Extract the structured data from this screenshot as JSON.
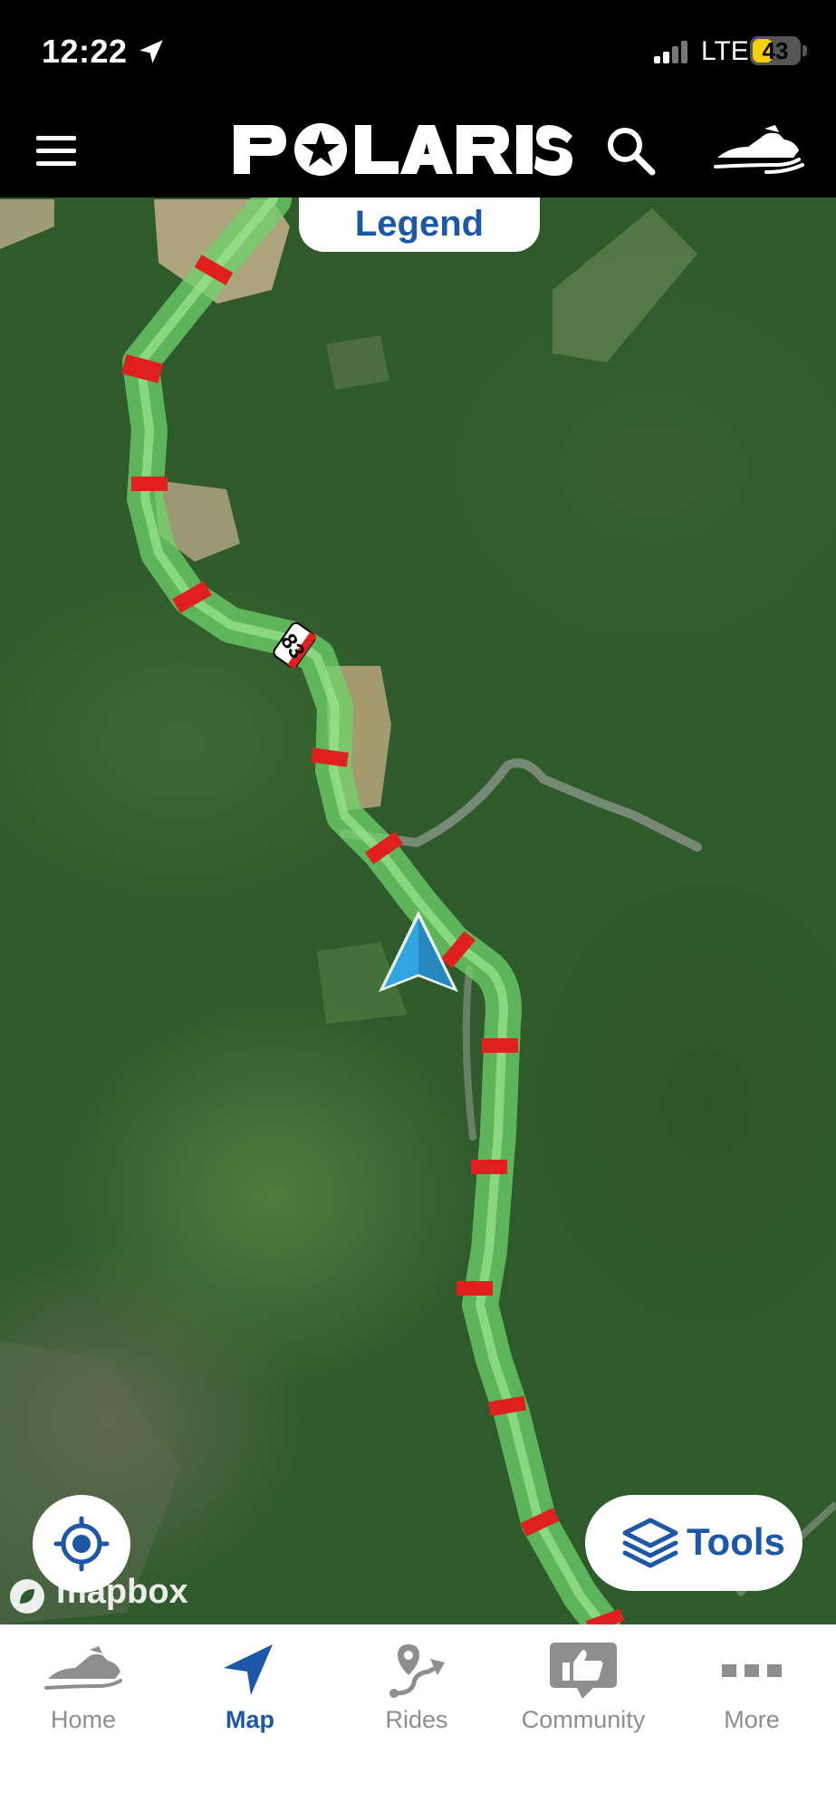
{
  "status_bar": {
    "time": "12:22",
    "network": "LTE",
    "battery_percent": "43",
    "battery_level": 0.43,
    "location_icon": "location-arrow-icon"
  },
  "header": {
    "brand": "POLARIS",
    "menu_icon": "hamburger-menu-icon",
    "search_icon": "search-icon",
    "vehicle_icon": "snowmobile-icon"
  },
  "map": {
    "legend_label": "Legend",
    "trail_number": "83",
    "attribution": "mapbox",
    "tools_label": "Tools",
    "colors": {
      "trail": "#6fd36a",
      "trail_markers": "#e0201c",
      "position_arrow": "#31a5df",
      "brand_blue": "#1d57a8"
    }
  },
  "tab_bar": {
    "tabs": [
      {
        "label": "Home",
        "icon": "snowmobile-icon",
        "active": false
      },
      {
        "label": "Map",
        "icon": "navigation-arrow-icon",
        "active": true
      },
      {
        "label": "Rides",
        "icon": "route-icon",
        "active": false
      },
      {
        "label": "Community",
        "icon": "thumbs-up-chat-icon",
        "active": false
      },
      {
        "label": "More",
        "icon": "more-dots-icon",
        "active": false
      }
    ]
  }
}
